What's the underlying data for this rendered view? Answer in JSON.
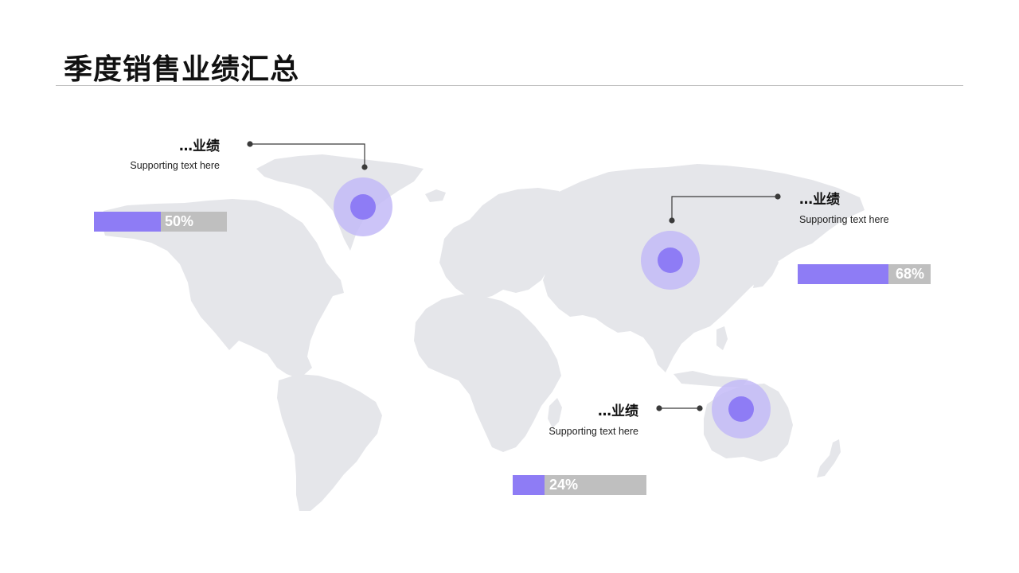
{
  "title": "季度销售业绩汇总",
  "colors": {
    "accent": "#8e7cf5",
    "accent_light": "#c3baf7",
    "map_fill": "#e5e6ea",
    "bar_track": "#bfbfbf",
    "leader": "#3a3a3a"
  },
  "callouts": [
    {
      "id": "north-america",
      "title": "…业绩",
      "subtitle": "Supporting  text here",
      "percent_label": "50%",
      "percent": 50
    },
    {
      "id": "asia",
      "title": "…业绩",
      "subtitle": "Supporting  text here",
      "percent_label": "68%",
      "percent": 68
    },
    {
      "id": "australia",
      "title": "…业绩",
      "subtitle": "Supporting  text here",
      "percent_label": "24%",
      "percent": 24
    }
  ]
}
